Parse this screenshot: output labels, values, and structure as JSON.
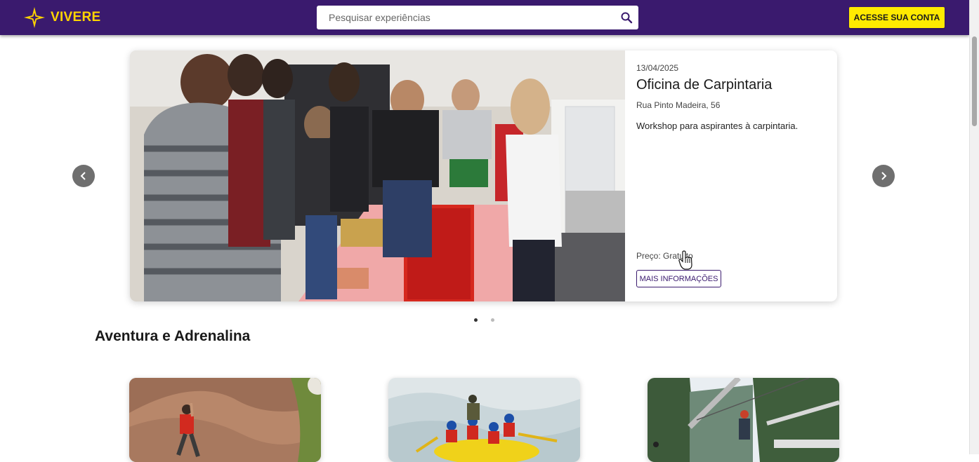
{
  "header": {
    "logo_text": "VIVERE",
    "search": {
      "placeholder": "Pesquisar experiências"
    },
    "login_label": "ACESSE SUA CONTA"
  },
  "carousel": {
    "date": "13/04/2025",
    "title": "Oficina de Carpintaria",
    "address": "Rua Pinto Madeira, 56",
    "description": "Workshop para aspirantes à carpintaria.",
    "price": "Preço: Gratuito",
    "more_label": "MAIS INFORMAÇÕES",
    "active_slide": 1,
    "slide_count": 2
  },
  "section": {
    "title": "Aventura e Adrenalina",
    "cards": [
      {
        "image": "rock-climbing-photo"
      },
      {
        "image": "rafting-photo"
      },
      {
        "image": "zipline-photo"
      }
    ]
  },
  "colors": {
    "header_bg": "#3a1a6e",
    "accent_yellow": "#ffea00",
    "logo_yellow": "#ffd400"
  },
  "icons": {
    "search": "magnifier-icon",
    "prev": "chevron-left-icon",
    "next": "chevron-right-icon",
    "cursor": "hand-pointer-icon"
  }
}
